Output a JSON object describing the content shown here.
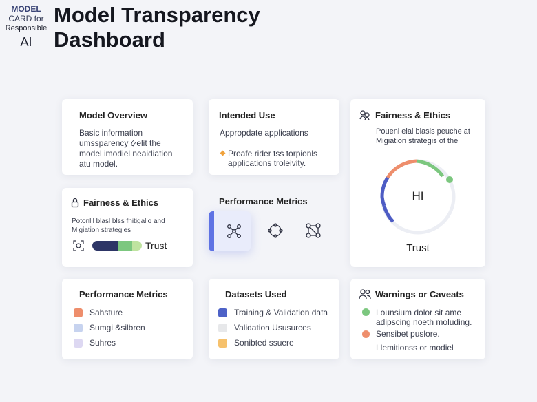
{
  "logo": {
    "line1": "MODEL",
    "line2": "CARD for",
    "line3": "Responsible",
    "line4": "AI"
  },
  "page_title": "Model Transparency Dashboard",
  "cards": {
    "model_overview": {
      "title": "Model Overview",
      "lines": [
        "Basic information",
        "umssparency ζ̷ elit the",
        "model imodiel neaidiation",
        "atu model."
      ]
    },
    "intended_use": {
      "title": "Intended Use",
      "subtitle": "Appropdate applications",
      "lines": [
        "Proafe rider tss torpionls",
        "applications troleivity."
      ]
    },
    "fairness_large": {
      "title": "Fairness & Ethics",
      "lines": [
        "Pouenl elal blasis peuche at",
        "Migiation strategis of the"
      ],
      "gauge_label": "HI",
      "caption": "Trust"
    },
    "fairness_small": {
      "title": "Fairness & Ethics",
      "lines": [
        "Potonlil blasl blss fhitigalio and",
        "Migiation strategies"
      ],
      "trust_label": "Trust"
    },
    "performance_top": {
      "title": "Performance Metrics"
    },
    "performance_bottom": {
      "title": "Performance Metrics",
      "items": [
        {
          "label": "Sahsture",
          "color": "#ee8e6c"
        },
        {
          "label": "Sumgi &silbren",
          "color": "#c7d3ef"
        },
        {
          "label": "Suhres",
          "color": "#ddd8f2"
        }
      ]
    },
    "datasets": {
      "title": "Datasets Used",
      "items": [
        {
          "label": "Training & Validation data",
          "color": "#4d62c7"
        },
        {
          "label": "Validation Ususurces",
          "color": "#e7e8ea"
        },
        {
          "label": "Sonibted ssuere",
          "color": "#f6c16c"
        }
      ]
    },
    "warnings": {
      "title": "Warnings or Caveats",
      "items": [
        {
          "label": "Lounsium dolor sit ame",
          "color": "#7cc77f"
        },
        {
          "label": "adipscing noeth moluding.",
          "color": null
        },
        {
          "label": "Sensibet puslore.",
          "color": "#ee8e6c"
        },
        {
          "label": "Llemitionss or modiel",
          "color": null
        }
      ]
    }
  },
  "colors": {
    "accent": "#5e72e4",
    "orange": "#ee8e6c",
    "green": "#7cc77f",
    "navy": "#2d3566"
  }
}
